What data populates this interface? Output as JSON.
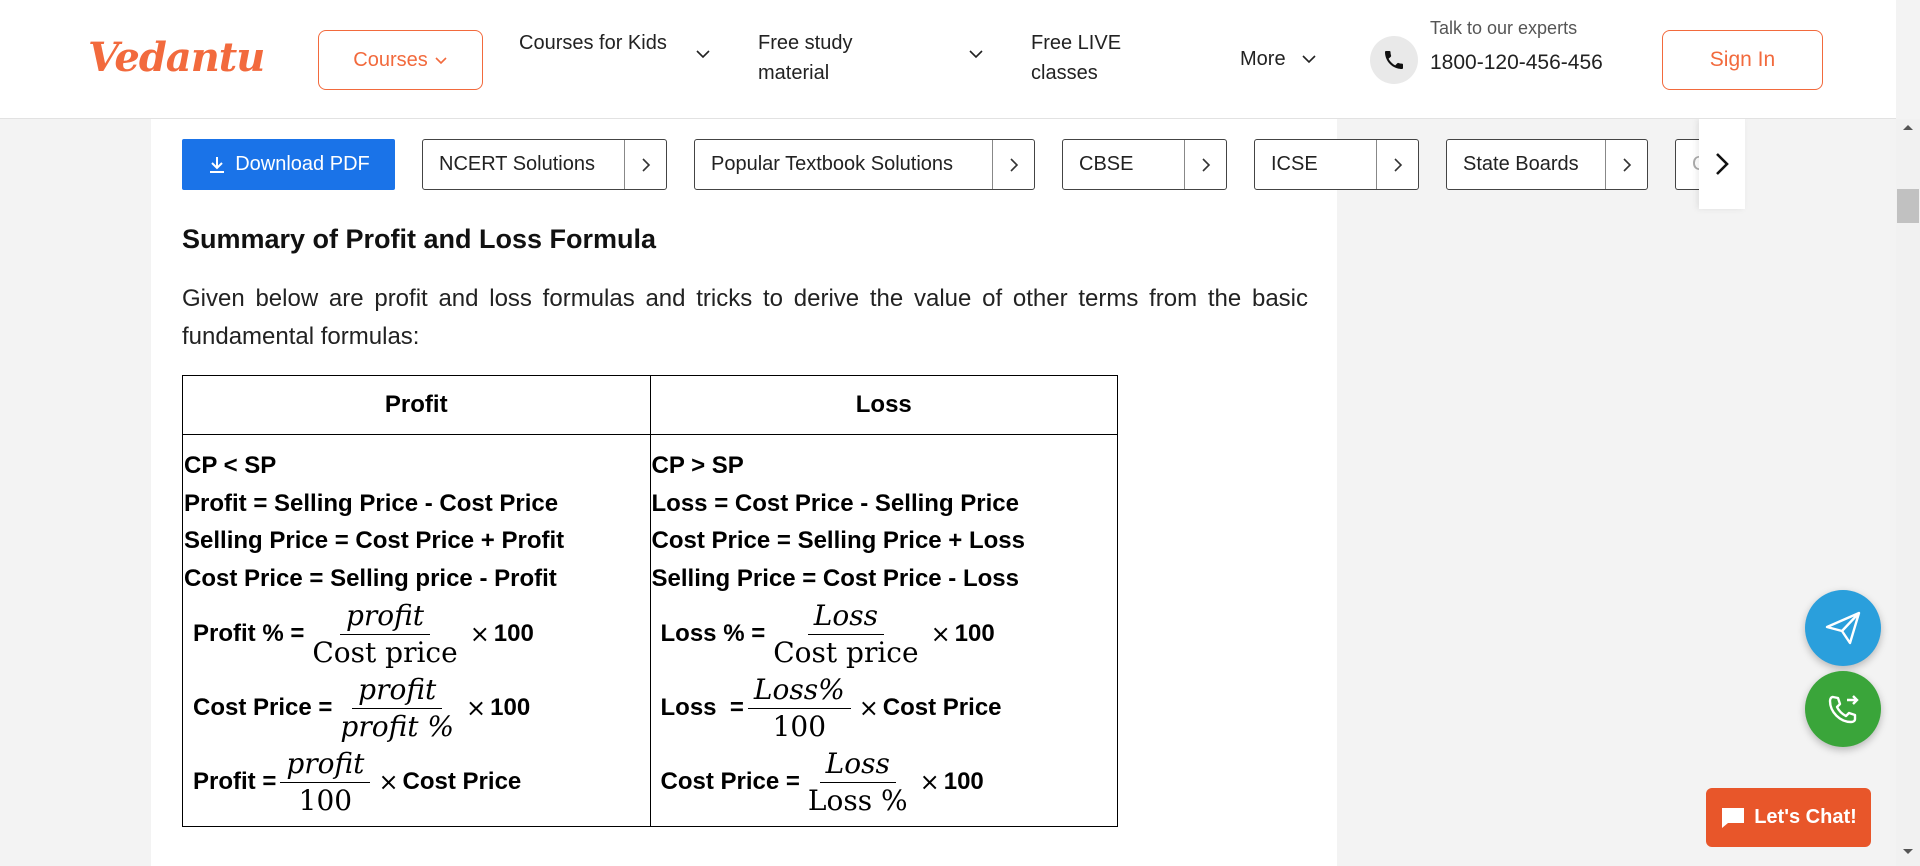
{
  "header": {
    "logo": "Vedantu",
    "courses_label": "Courses",
    "nav": [
      {
        "label": "Courses for Kids"
      },
      {
        "label": "Free study material"
      },
      {
        "label": "Free LIVE classes"
      },
      {
        "label": "More"
      }
    ],
    "talk_label": "Talk to our experts",
    "phone": "1800-120-456-456",
    "signin_label": "Sign In"
  },
  "toolbar": {
    "download_label": "Download PDF",
    "chips": [
      {
        "label": "NCERT Solutions"
      },
      {
        "label": "Popular Textbook Solutions"
      },
      {
        "label": "CBSE"
      },
      {
        "label": "ICSE"
      },
      {
        "label": "State Boards"
      },
      {
        "label": "C"
      }
    ]
  },
  "article": {
    "heading": "Summary of Profit and Loss Formula",
    "paragraph": "Given below are profit and loss formulas and tricks to derive the value of other terms from the basic fundamental formulas:",
    "table": {
      "headers": [
        "Profit",
        "Loss"
      ],
      "profit": {
        "lines": [
          "CP < SP",
          "Profit = Selling Price - Cost Price",
          "Selling Price = Cost Price + Profit",
          "Cost Price = Selling price - Profit"
        ],
        "f1": {
          "label": "Profit % =",
          "num": "profit",
          "den": "Cost price",
          "tail": "100"
        },
        "f2": {
          "label": "Cost Price =",
          "num": "profit",
          "den": "profit %",
          "tail": "100"
        },
        "f3": {
          "label": "Profit =",
          "num": "profit",
          "den": "100",
          "tail": "Cost Price"
        }
      },
      "loss": {
        "lines": [
          "CP > SP",
          "Loss = Cost Price - Selling Price",
          "Cost Price = Selling Price + Loss",
          "Selling Price = Cost Price - Loss"
        ],
        "f1": {
          "label": "Loss % =",
          "num": "Loss",
          "den": "Cost price",
          "tail": "100"
        },
        "f2": {
          "label": "Loss  =",
          "num": "Loss%",
          "den": "100",
          "tail": "Cost Price"
        },
        "f3": {
          "label": "Cost Price =",
          "num": "Loss",
          "den": "Loss %",
          "tail": "100"
        }
      }
    }
  },
  "chat_label": "Let's Chat!",
  "colors": {
    "brand": "#f26a3d",
    "download": "#1a73e8",
    "send": "#2a9fdc",
    "call": "#3aa53a",
    "chat": "#e8562a"
  }
}
